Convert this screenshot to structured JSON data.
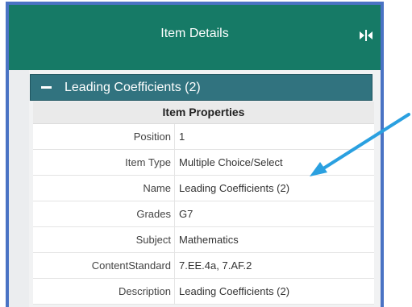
{
  "panel": {
    "title": "Item Details",
    "collapse_icon": "collapse-panel-icon"
  },
  "section": {
    "title": "Leading Coefficients (2)",
    "toggle_icon": "minus-icon"
  },
  "properties": {
    "heading": "Item Properties",
    "rows": [
      {
        "label": "Position",
        "value": "1"
      },
      {
        "label": "Item Type",
        "value": "Multiple Choice/Select"
      },
      {
        "label": "Name",
        "value": "Leading Coefficients (2)"
      },
      {
        "label": "Grades",
        "value": "G7"
      },
      {
        "label": "Subject",
        "value": "Mathematics"
      },
      {
        "label": "ContentStandard",
        "value": "7.EE.4a, 7.AF.2"
      },
      {
        "label": "Description",
        "value": "Leading Coefficients (2)"
      }
    ]
  },
  "colors": {
    "header": "#167a66",
    "section": "#31737f",
    "frame": "#4a73c4",
    "annotation_arrow": "#2aa0e0"
  }
}
